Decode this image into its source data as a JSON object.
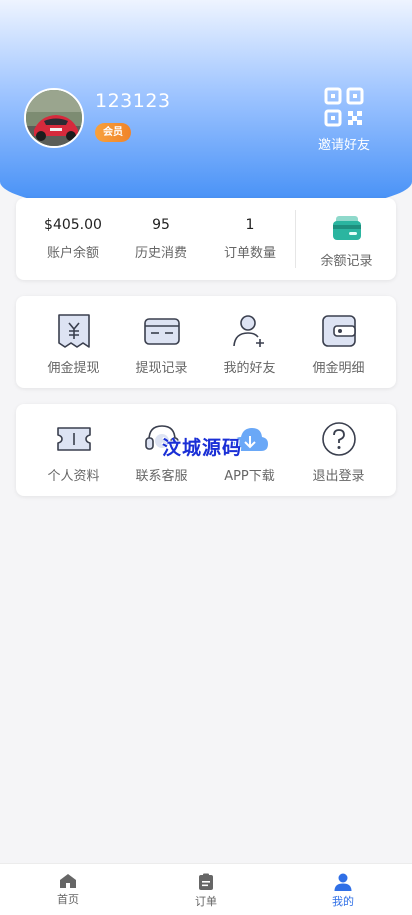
{
  "profile": {
    "username": "123123",
    "badge": "会员",
    "invite_label": "邀请好友"
  },
  "stats": [
    {
      "value": "$405.00",
      "label": "账户余额"
    },
    {
      "value": "95",
      "label": "历史消费"
    },
    {
      "value": "1",
      "label": "订单数量"
    }
  ],
  "balance_record_label": "余额记录",
  "menu_row1": [
    {
      "label": "佣金提现",
      "icon": "commission-withdraw-icon"
    },
    {
      "label": "提现记录",
      "icon": "card-icon"
    },
    {
      "label": "我的好友",
      "icon": "add-friend-icon"
    },
    {
      "label": "佣金明细",
      "icon": "wallet-icon"
    }
  ],
  "menu_row2": [
    {
      "label": "个人资料",
      "icon": "ticket-icon"
    },
    {
      "label": "联系客服",
      "icon": "headset-icon"
    },
    {
      "label": "APP下载",
      "icon": "cloud-icon"
    },
    {
      "label": "退出登录",
      "icon": "question-icon"
    }
  ],
  "watermark": "汶城源码",
  "tabbar": [
    {
      "label": "首页",
      "icon": "home-icon",
      "active": false
    },
    {
      "label": "订单",
      "icon": "order-icon",
      "active": false
    },
    {
      "label": "我的",
      "icon": "user-icon",
      "active": true
    }
  ],
  "colors": {
    "accent": "#3d8bf5",
    "active_tab": "#2f6fe6",
    "badge": "#f0842a",
    "teal": "#2bb5a0"
  }
}
